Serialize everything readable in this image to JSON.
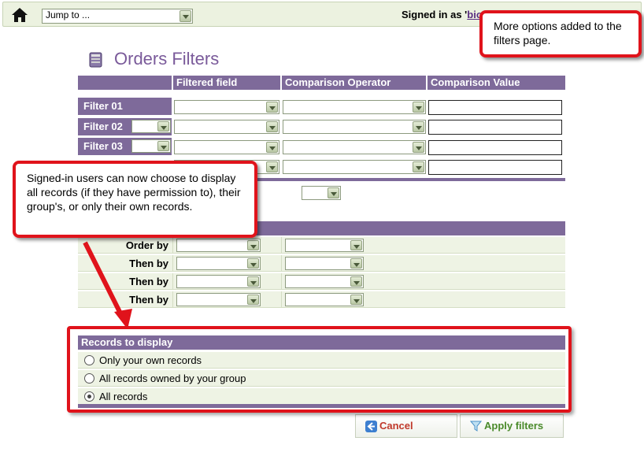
{
  "topbar": {
    "jump_to": "Jump to ...",
    "signed_in_prefix": "Signed in as '",
    "signed_in_user": "bio"
  },
  "page": {
    "title": "Orders Filters"
  },
  "filters": {
    "headers": {
      "field": "Filtered field",
      "operator": "Comparison Operator",
      "value": "Comparison Value"
    },
    "rows": [
      {
        "label": "Filter 01"
      },
      {
        "label": "Filter 02"
      },
      {
        "label": "Filter 03"
      }
    ]
  },
  "sorting": {
    "rows": [
      {
        "label": "Order by"
      },
      {
        "label": "Then by"
      },
      {
        "label": "Then by"
      },
      {
        "label": "Then by"
      }
    ]
  },
  "records": {
    "header": "Records to display",
    "options": [
      {
        "label": "Only your own records",
        "checked": false
      },
      {
        "label": "All records owned by your group",
        "checked": false
      },
      {
        "label": "All records",
        "checked": true
      }
    ]
  },
  "buttons": {
    "cancel": "Cancel",
    "apply": "Apply filters"
  },
  "callouts": {
    "top": "More options added to the filters page.",
    "left": "Signed-in users can now choose to display all records (if they have permission to), their group's, or only their own records."
  },
  "colors": {
    "header_purple": "#7e6a9a",
    "row_green": "#eef3e4",
    "callout_red": "#e0131b"
  }
}
